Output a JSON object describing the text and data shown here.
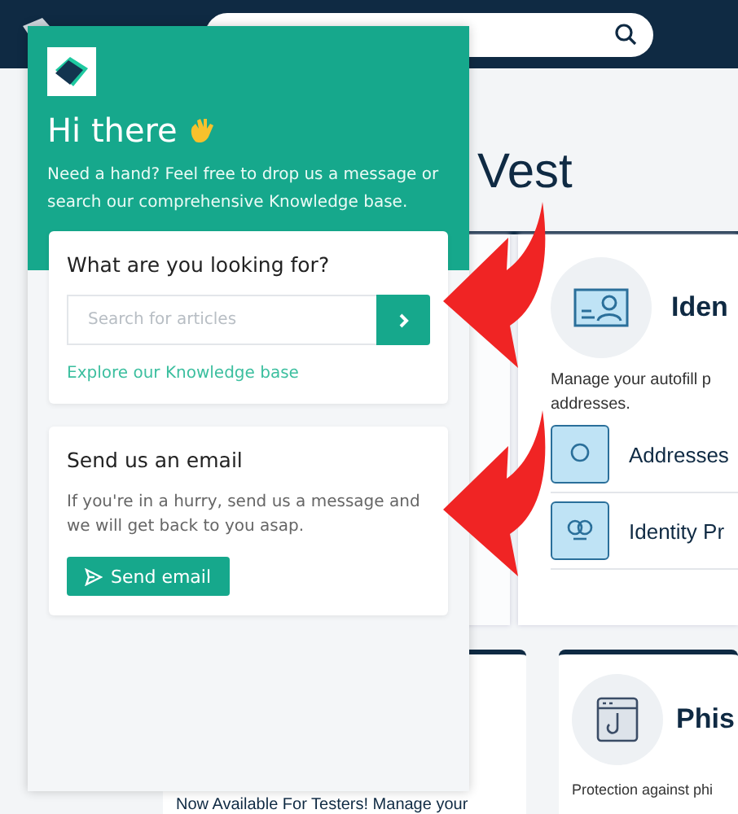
{
  "page": {
    "heading": "Vest",
    "feature_card": {
      "title": "Iden",
      "description": "Manage your autofill p addresses.",
      "rows": [
        {
          "label": "Addresses"
        },
        {
          "label": "Identity Pr"
        }
      ]
    },
    "bottom_cards": [
      {
        "kind": "text",
        "text": "Now Available For Testers! Manage your"
      },
      {
        "kind": "feature",
        "title": "Phis",
        "description": "Protection against phi"
      }
    ]
  },
  "widget": {
    "title": "Hi there",
    "intro": "Need a hand? Feel free to drop us a message or search our comprehensive Knowledge base.",
    "search_card": {
      "title": "What are you looking for?",
      "placeholder": "Search for articles",
      "link": "Explore our Knowledge base"
    },
    "email_card": {
      "title": "Send us an email",
      "text": "If you're in a hurry, send us a message and we will get back to you asap.",
      "button": "Send email"
    }
  }
}
